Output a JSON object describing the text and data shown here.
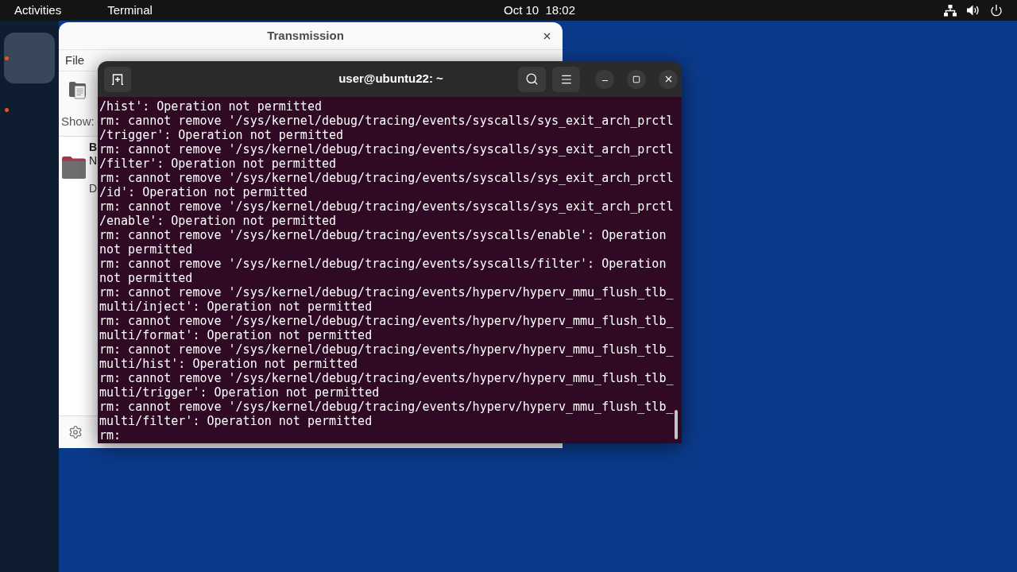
{
  "top_bar": {
    "activities": "Activities",
    "app_menu": "Terminal",
    "clock": "Oct 10  18:02"
  },
  "dock": {
    "items": [
      {
        "selected": true,
        "running": true
      },
      {
        "selected": false,
        "running": true
      }
    ]
  },
  "transmission": {
    "title": "Transmission",
    "menu": [
      "File"
    ],
    "filter_label": "Show:",
    "torrents": [
      {
        "name": "B",
        "line_2": "N",
        "line_3": "D"
      }
    ]
  },
  "terminal": {
    "title": "user@ubuntu22: ~",
    "lines": [
      "/hist': Operation not permitted",
      "rm: cannot remove '/sys/kernel/debug/tracing/events/syscalls/sys_exit_arch_prctl",
      "/trigger': Operation not permitted",
      "rm: cannot remove '/sys/kernel/debug/tracing/events/syscalls/sys_exit_arch_prctl",
      "/filter': Operation not permitted",
      "rm: cannot remove '/sys/kernel/debug/tracing/events/syscalls/sys_exit_arch_prctl",
      "/id': Operation not permitted",
      "rm: cannot remove '/sys/kernel/debug/tracing/events/syscalls/sys_exit_arch_prctl",
      "/enable': Operation not permitted",
      "rm: cannot remove '/sys/kernel/debug/tracing/events/syscalls/enable': Operation",
      "not permitted",
      "rm: cannot remove '/sys/kernel/debug/tracing/events/syscalls/filter': Operation",
      "not permitted",
      "rm: cannot remove '/sys/kernel/debug/tracing/events/hyperv/hyperv_mmu_flush_tlb_",
      "multi/inject': Operation not permitted",
      "rm: cannot remove '/sys/kernel/debug/tracing/events/hyperv/hyperv_mmu_flush_tlb_",
      "multi/format': Operation not permitted",
      "rm: cannot remove '/sys/kernel/debug/tracing/events/hyperv/hyperv_mmu_flush_tlb_",
      "multi/hist': Operation not permitted",
      "rm: cannot remove '/sys/kernel/debug/tracing/events/hyperv/hyperv_mmu_flush_tlb_",
      "multi/trigger': Operation not permitted",
      "rm: cannot remove '/sys/kernel/debug/tracing/events/hyperv/hyperv_mmu_flush_tlb_",
      "multi/filter': Operation not permitted",
      "rm:"
    ]
  }
}
